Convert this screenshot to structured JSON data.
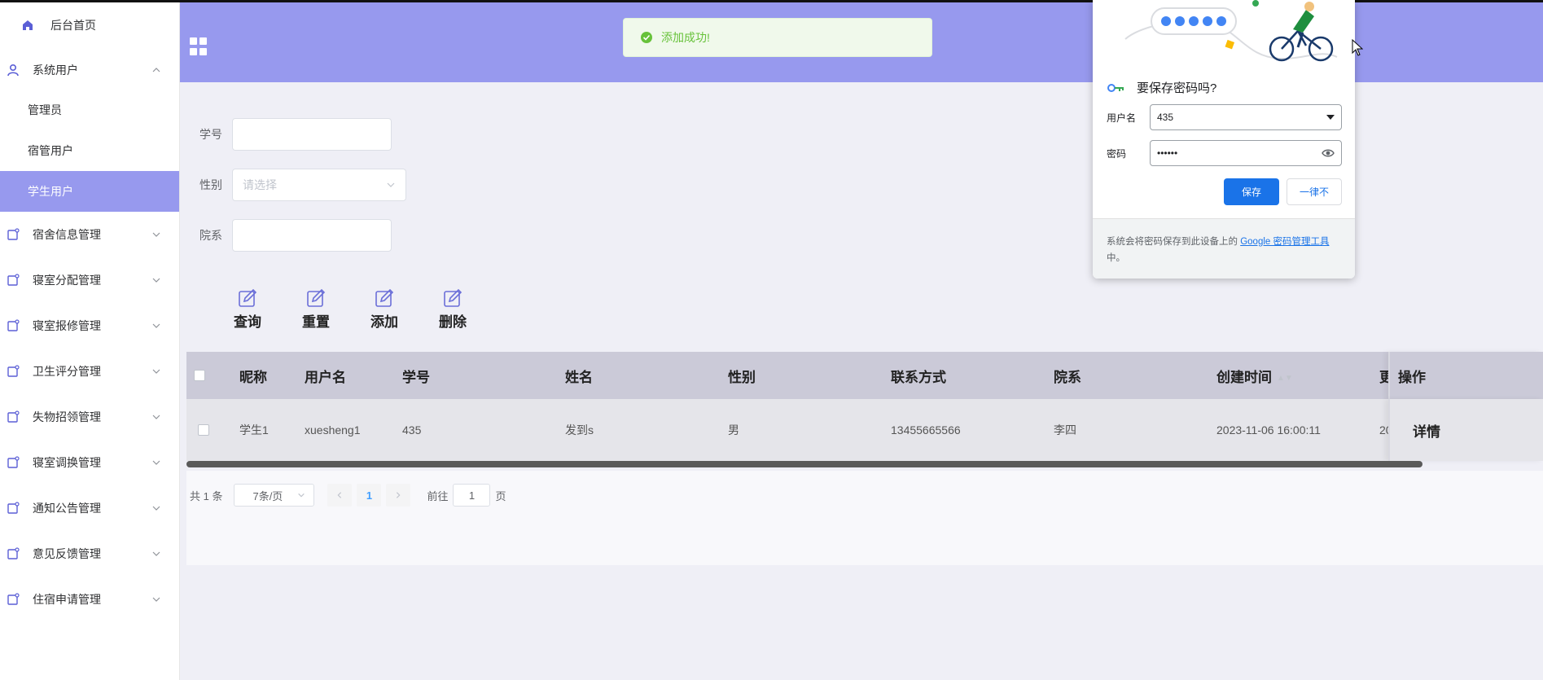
{
  "sidebar": {
    "home": "后台首页",
    "users_group": "系统用户",
    "sub_items": [
      "管理员",
      "宿管用户",
      "学生用户"
    ],
    "groups": [
      "宿舍信息管理",
      "寝室分配管理",
      "寝室报修管理",
      "卫生评分管理",
      "失物招领管理",
      "寝室调换管理",
      "通知公告管理",
      "意见反馈管理",
      "住宿申请管理"
    ]
  },
  "toast": {
    "message": "添加成功!"
  },
  "search": {
    "student_no_label": "学号",
    "gender_label": "性别",
    "gender_placeholder": "请选择",
    "dept_label": "院系"
  },
  "buttons": {
    "query": "查询",
    "reset": "重置",
    "add": "添加",
    "delete": "删除"
  },
  "table": {
    "columns": [
      "昵称",
      "用户名",
      "学号",
      "姓名",
      "性别",
      "联系方式",
      "院系",
      "创建时间",
      "更",
      "操作"
    ],
    "rows": [
      {
        "nickname": "学生1",
        "username": "xuesheng1",
        "student_no": "435",
        "name": "发到s",
        "gender": "男",
        "phone": "13455665566",
        "dept": "李四",
        "created": "2023-11-06 16:00:11",
        "updated": "20",
        "action": "详情"
      }
    ]
  },
  "pagination": {
    "total": "共 1 条",
    "page_size": "7条/页",
    "current": "1",
    "goto_prefix": "前往",
    "goto_value": "1",
    "goto_suffix": "页"
  },
  "password_popup": {
    "title": "要保存密码吗?",
    "username_label": "用户名",
    "username_value": "435",
    "password_label": "密码",
    "password_value": "••••••",
    "save_label": "保存",
    "never_label": "一律不",
    "footer_text": "系统会将密码保存到此设备上的 ",
    "footer_link": "Google 密码管理工具",
    "footer_tail": "中。"
  },
  "colors": {
    "header": "#9799ee",
    "active_menu": "#9799ee",
    "accent_blue": "#1a73e8",
    "success": "#67c23a"
  }
}
